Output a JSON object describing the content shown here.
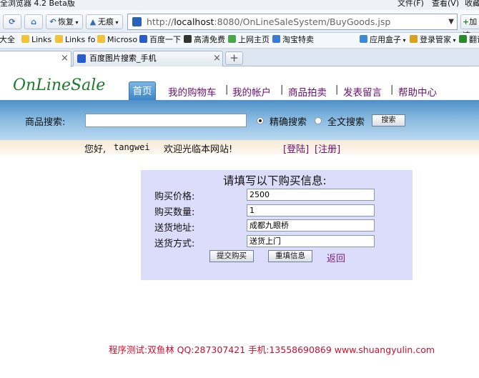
{
  "browser": {
    "title": "全浏览器 4.2 Beta版",
    "menu": [
      "文件(F)",
      "查看(V)",
      "收藏"
    ],
    "toolbar": {
      "back_label": "恢复",
      "traceless_label": "无痕"
    },
    "address": {
      "scheme": "http://",
      "host": "localhost",
      "rest": ":8080/OnLineSaleSystem/BuyGoods.jsp"
    },
    "add_label": "加速",
    "favorites": [
      "大全",
      "Links",
      "Links fo",
      "Microso",
      "百度一下",
      "高清免费",
      "上网主页",
      "淘宝特卖",
      "应用盒子",
      "登录管家",
      "翻译"
    ],
    "tabs": [
      {
        "label": ""
      },
      {
        "label": "百度图片搜索_手机"
      }
    ],
    "new_tab": "+"
  },
  "site": {
    "logo": "OnLineSale",
    "nav": [
      "首页",
      "我的购物车",
      "我的帐户",
      "商品拍卖",
      "发表留言",
      "帮助中心"
    ],
    "nav_sep": "|",
    "search": {
      "label": "商品搜索:",
      "value": "",
      "options": [
        "精确搜索",
        "全文搜索"
      ],
      "selected": "精确搜索",
      "button": "搜索"
    },
    "welcome": {
      "greeting": "您好,",
      "user": "tangwei",
      "message": "欢迎光临本网站!",
      "login": "[登陆]",
      "register": "[注册]"
    }
  },
  "form": {
    "title": "请填写以下购买信息:",
    "fields": [
      {
        "label": "购买价格:",
        "value": "2500"
      },
      {
        "label": "购买数量:",
        "value": "1"
      },
      {
        "label": "送货地址:",
        "value": "成都九眼桥"
      },
      {
        "label": "送货方式:",
        "value": "送货上门"
      }
    ],
    "submit": "提交购买",
    "reset": "重填信息",
    "back": "返回"
  },
  "footer": "程序测试:双鱼林 QQ:287307421 手机:13558690869 www.shuangyulin.com"
}
